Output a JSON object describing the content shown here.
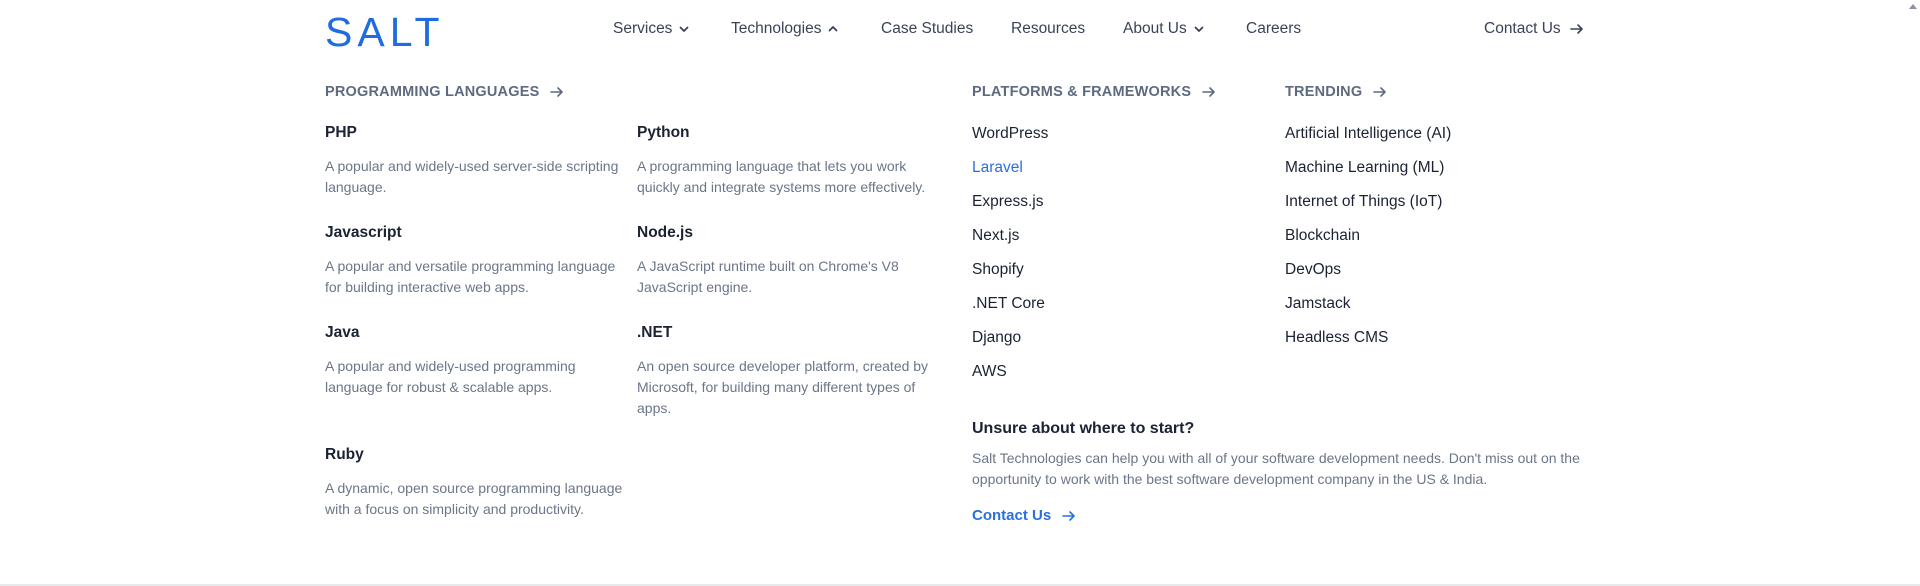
{
  "brand": {
    "logo_text": "SALT",
    "accent": "#1f6ce0"
  },
  "nav": {
    "items": [
      {
        "label": "Services",
        "icon": "chevron-down-icon"
      },
      {
        "label": "Technologies",
        "icon": "chevron-up-icon"
      },
      {
        "label": "Case Studies"
      },
      {
        "label": "Resources"
      },
      {
        "label": "About Us",
        "icon": "chevron-down-icon"
      },
      {
        "label": "Careers"
      }
    ],
    "contact_label": "Contact Us"
  },
  "menu": {
    "programming": {
      "title": "PROGRAMMING LANGUAGES",
      "items": [
        {
          "name": "PHP",
          "desc": "A popular and widely-used server-side scripting language."
        },
        {
          "name": "Python",
          "desc": "A programming language that lets you work quickly and integrate systems more effectively."
        },
        {
          "name": "Javascript",
          "desc": "A popular and versatile programming language for building interactive web apps."
        },
        {
          "name": "Node.js",
          "desc": "A JavaScript runtime built on Chrome's V8 JavaScript engine."
        },
        {
          "name": "Java",
          "desc": "A popular and widely-used programming language for robust & scalable apps."
        },
        {
          "name": ".NET",
          "desc": "An open source developer platform, created by Microsoft, for building many different types of apps."
        },
        {
          "name": "Ruby",
          "desc": "A dynamic, open source programming language with a focus on simplicity and productivity."
        }
      ]
    },
    "platforms": {
      "title": "PLATFORMS & FRAMEWORKS",
      "items": [
        "WordPress",
        "Laravel",
        "Express.js",
        "Next.js",
        "Shopify",
        ".NET Core",
        "Django",
        "AWS"
      ],
      "active_item": "Laravel"
    },
    "trending": {
      "title": "TRENDING",
      "items": [
        "Artificial Intelligence (AI)",
        "Machine Learning (ML)",
        "Internet of Things (IoT)",
        "Blockchain",
        "DevOps",
        "Jamstack",
        "Headless CMS"
      ]
    },
    "unsure": {
      "title": "Unsure about where to start?",
      "text": "Salt Technologies can help you with all of your software development needs. Don't miss out on the opportunity to work with the best software development company in the US & India.",
      "cta": "Contact Us"
    }
  },
  "colors": {
    "link_blue": "#2a6fe0",
    "muted": "#6b7689",
    "heading": "#1a2233"
  }
}
